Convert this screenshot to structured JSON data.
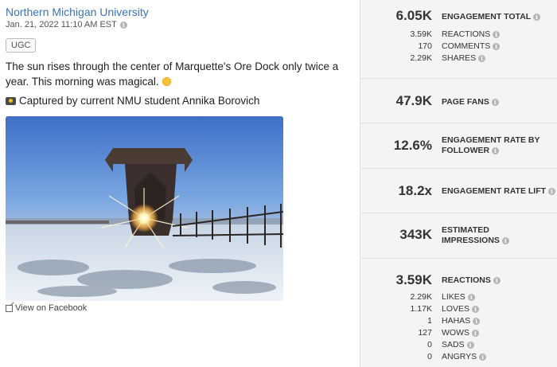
{
  "post": {
    "org_name": "Northern Michigan University",
    "date": "Jan. 21, 2022 11:10 AM EST",
    "badge": "UGC",
    "text": "The sun rises through the center of Marquette's Ore Dock only twice a year. This morning was magical.",
    "caption": "Captured by current NMU student Annika Borovich",
    "view_link": "View on Facebook"
  },
  "stats": {
    "engagement_total": {
      "value": "6.05K",
      "label": "ENGAGEMENT TOTAL"
    },
    "breakdown": [
      {
        "value": "3.59K",
        "label": "REACTIONS"
      },
      {
        "value": "170",
        "label": "COMMENTS"
      },
      {
        "value": "2.29K",
        "label": "SHARES"
      }
    ],
    "page_fans": {
      "value": "47.9K",
      "label": "PAGE FANS"
    },
    "engagement_rate": {
      "value": "12.6%",
      "label_1": "ENGAGEMENT RATE BY",
      "label_2": "FOLLOWER"
    },
    "engagement_lift": {
      "value": "18.2x",
      "label": "ENGAGEMENT RATE LIFT"
    },
    "impressions": {
      "value": "343K",
      "label_1": "ESTIMATED",
      "label_2": "IMPRESSIONS"
    },
    "reactions": {
      "value": "3.59K",
      "label": "REACTIONS"
    },
    "reaction_types": [
      {
        "value": "2.29K",
        "label": "LIKES"
      },
      {
        "value": "1.17K",
        "label": "LOVES"
      },
      {
        "value": "1",
        "label": "HAHAS"
      },
      {
        "value": "127",
        "label": "WOWS"
      },
      {
        "value": "0",
        "label": "SADS"
      },
      {
        "value": "0",
        "label": "ANGRYS"
      }
    ]
  },
  "colors": {
    "link": "#3b73b9",
    "panel_bg": "#f4f4f4"
  }
}
